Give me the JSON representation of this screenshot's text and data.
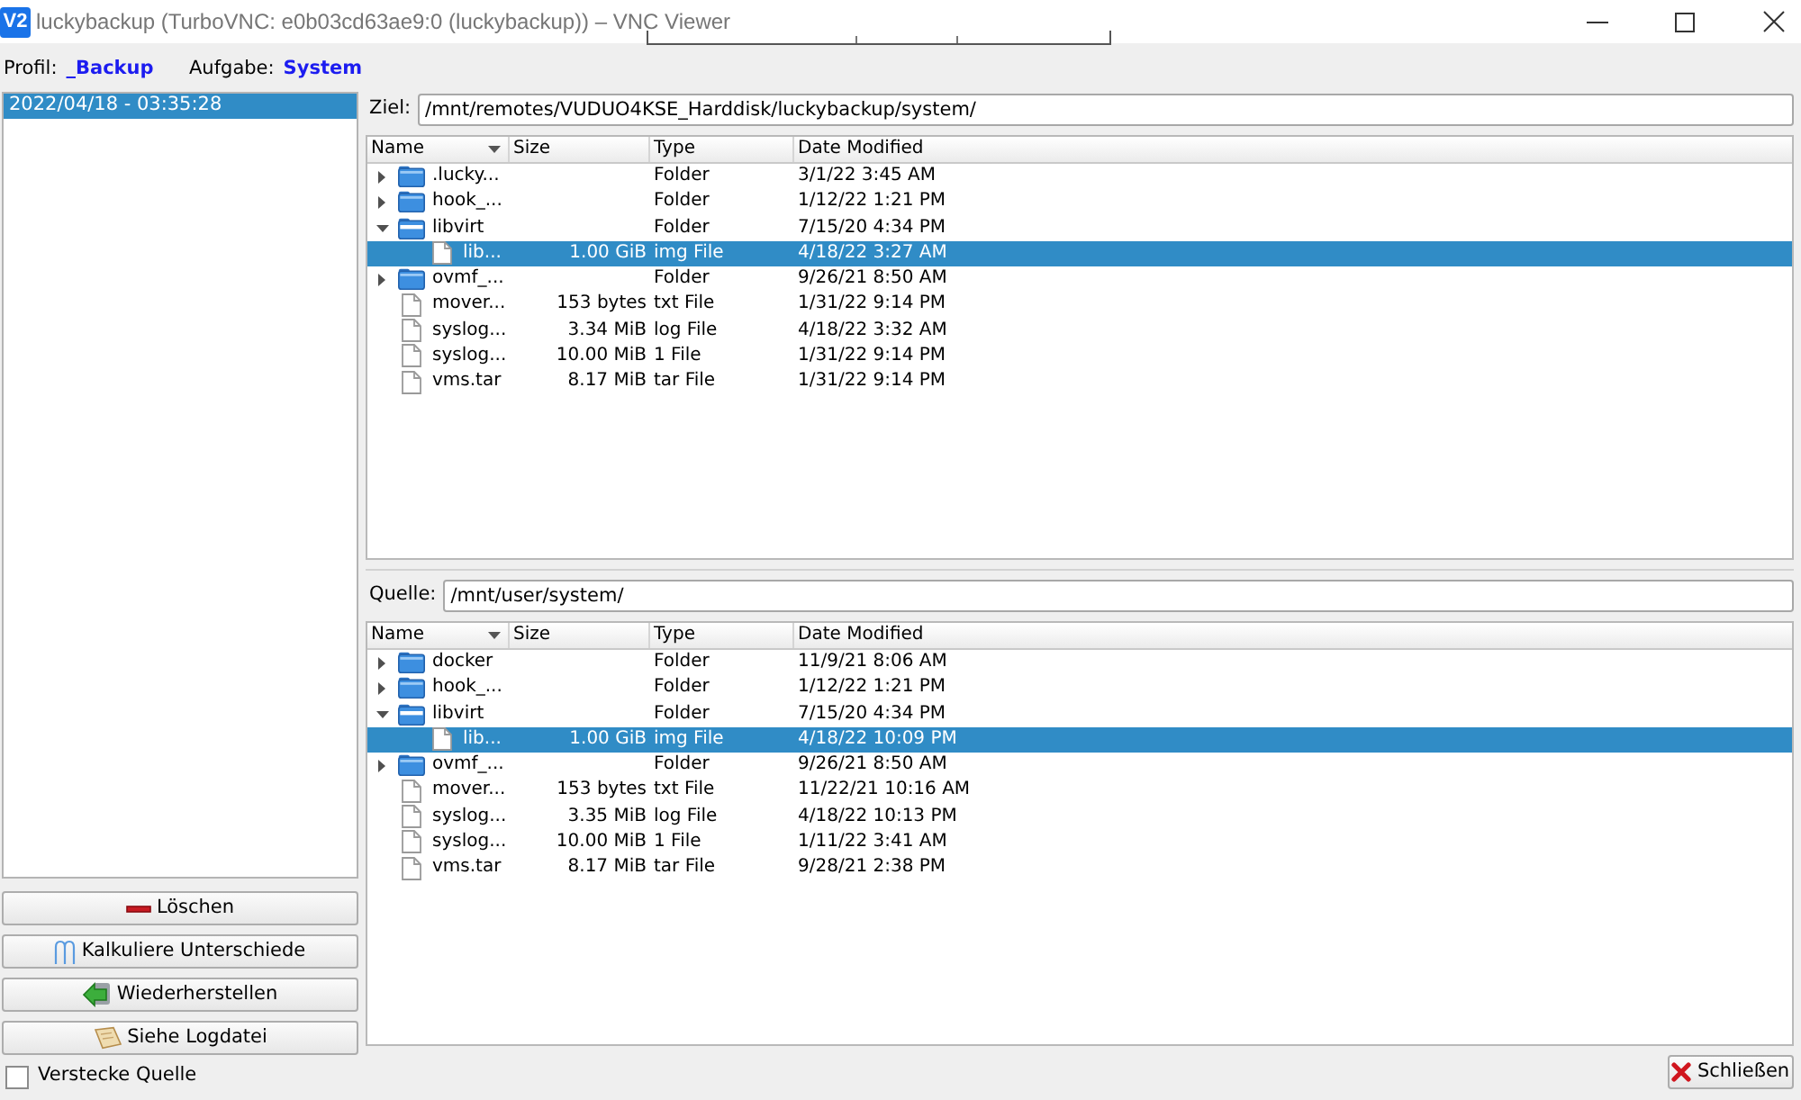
{
  "window": {
    "logo": "V2",
    "title": "luckybackup (TurboVNC: e0b03cd63ae9:0 (luckybackup)) – VNC Viewer"
  },
  "header": {
    "profile_label": "Profil:",
    "profile": "_Backup",
    "task_label": "Aufgabe:",
    "task": "System"
  },
  "snapshots": [
    {
      "label": "2022/04/18 - 03:35:28",
      "selected": true
    }
  ],
  "actions": [
    {
      "label": "Löschen",
      "kind": "delete"
    },
    {
      "label": "Kalkuliere Unterschiede",
      "kind": "compare"
    },
    {
      "label": "Wiederherstellen",
      "kind": "restore"
    },
    {
      "label": "Siehe Logdatei",
      "kind": "log"
    }
  ],
  "hide_source": {
    "label": "Verstecke Quelle",
    "checked": false
  },
  "panes": [
    {
      "label": "Ziel:",
      "path": "/mnt/remotes/VUDUO4KSE_Harddisk/luckybackup/system/",
      "columns": [
        {
          "label": "Name",
          "sorted": true
        },
        {
          "label": "Size",
          "sorted": false
        },
        {
          "label": "Type",
          "sorted": false
        },
        {
          "label": "Date Modified",
          "sorted": false
        }
      ],
      "rows": [
        {
          "name": ".lucky...",
          "kind": "folder",
          "expanded": false,
          "selected": false,
          "type": "Folder",
          "modified": "3/1/22 3:45 AM"
        },
        {
          "name": "hook_...",
          "kind": "folder",
          "expanded": false,
          "selected": false,
          "type": "Folder",
          "modified": "1/12/22 1:21 PM"
        },
        {
          "name": "libvirt",
          "kind": "folder",
          "expanded": true,
          "selected": false,
          "type": "Folder",
          "modified": "7/15/20 4:34 PM",
          "children": [
            {
              "name": "lib...",
              "kind": "file",
              "selected": true,
              "size": "1.00 GiB",
              "type": "img File",
              "modified": "4/18/22 3:27 AM"
            }
          ]
        },
        {
          "name": "ovmf_...",
          "kind": "folder",
          "expanded": false,
          "selected": false,
          "type": "Folder",
          "modified": "9/26/21 8:50 AM"
        },
        {
          "name": "mover...",
          "kind": "file",
          "selected": false,
          "size": "153 bytes",
          "type": "txt File",
          "modified": "1/31/22 9:14 PM"
        },
        {
          "name": "syslog...",
          "kind": "file",
          "selected": false,
          "size": "3.34 MiB",
          "type": "log File",
          "modified": "4/18/22 3:32 AM"
        },
        {
          "name": "syslog...",
          "kind": "file",
          "selected": false,
          "size": "10.00 MiB",
          "type": "1 File",
          "modified": "1/31/22 9:14 PM"
        },
        {
          "name": "vms.tar",
          "kind": "file",
          "selected": false,
          "size": "8.17 MiB",
          "type": "tar File",
          "modified": "1/31/22 9:14 PM"
        }
      ]
    },
    {
      "label": "Quelle:",
      "path": "/mnt/user/system/",
      "columns": [
        {
          "label": "Name",
          "sorted": true
        },
        {
          "label": "Size",
          "sorted": false
        },
        {
          "label": "Type",
          "sorted": false
        },
        {
          "label": "Date Modified",
          "sorted": false
        }
      ],
      "rows": [
        {
          "name": "docker",
          "kind": "folder",
          "expanded": false,
          "selected": false,
          "type": "Folder",
          "modified": "11/9/21 8:06 AM"
        },
        {
          "name": "hook_...",
          "kind": "folder",
          "expanded": false,
          "selected": false,
          "type": "Folder",
          "modified": "1/12/22 1:21 PM"
        },
        {
          "name": "libvirt",
          "kind": "folder",
          "expanded": true,
          "selected": false,
          "type": "Folder",
          "modified": "7/15/20 4:34 PM",
          "children": [
            {
              "name": "lib...",
              "kind": "file",
              "selected": true,
              "size": "1.00 GiB",
              "type": "img File",
              "modified": "4/18/22 10:09 PM"
            }
          ]
        },
        {
          "name": "ovmf_...",
          "kind": "folder",
          "expanded": false,
          "selected": false,
          "type": "Folder",
          "modified": "9/26/21 8:50 AM"
        },
        {
          "name": "mover...",
          "kind": "file",
          "selected": false,
          "size": "153 bytes",
          "type": "txt File",
          "modified": "11/22/21 10:16 AM"
        },
        {
          "name": "syslog...",
          "kind": "file",
          "selected": false,
          "size": "3.35 MiB",
          "type": "log File",
          "modified": "4/18/22 10:13 PM"
        },
        {
          "name": "syslog...",
          "kind": "file",
          "selected": false,
          "size": "10.00 MiB",
          "type": "1 File",
          "modified": "1/11/22 3:41 AM"
        },
        {
          "name": "vms.tar",
          "kind": "file",
          "selected": false,
          "size": "8.17 MiB",
          "type": "tar File",
          "modified": "9/28/21 2:38 PM"
        }
      ]
    }
  ],
  "close_button": {
    "label": "Schließen"
  }
}
